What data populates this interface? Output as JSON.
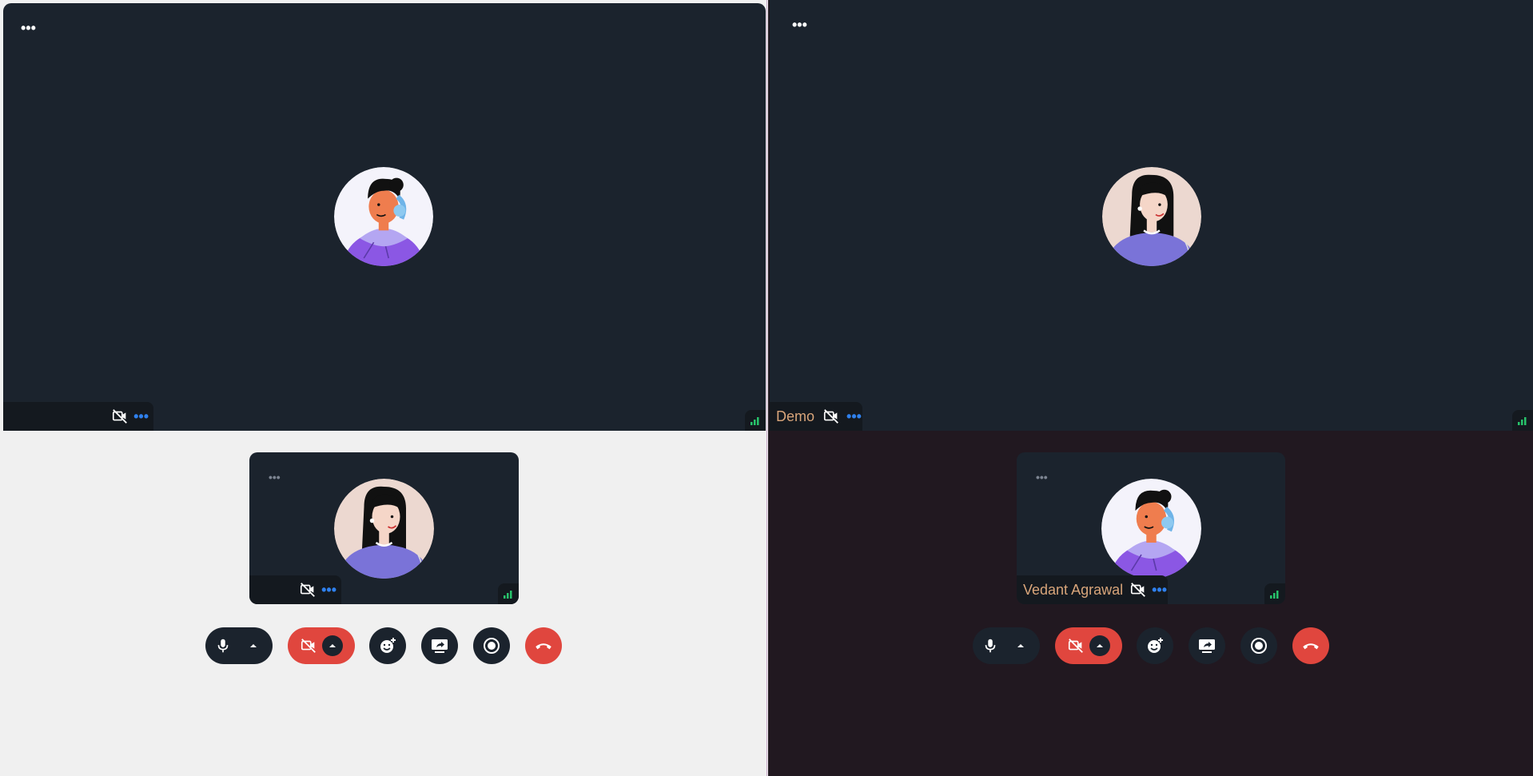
{
  "left_pane": {
    "main_tile": {
      "menu_icon": "more-horizontal-icon",
      "participant_name": "",
      "avatar": "avatar-headset-person",
      "video_off_icon": "video-off-icon",
      "options_icon": "more-horizontal-icon",
      "signal_icon": "signal-strength-icon"
    },
    "self_tile": {
      "menu_icon": "more-horizontal-icon",
      "participant_name": "",
      "avatar": "avatar-long-hair-person",
      "video_off_icon": "video-off-icon",
      "options_icon": "more-horizontal-icon",
      "signal_icon": "signal-strength-icon"
    }
  },
  "right_pane": {
    "main_tile": {
      "menu_icon": "more-horizontal-icon",
      "participant_name": "Demo",
      "avatar": "avatar-long-hair-person",
      "video_off_icon": "video-off-icon",
      "options_icon": "more-horizontal-icon",
      "signal_icon": "signal-strength-icon"
    },
    "self_tile": {
      "menu_icon": "more-horizontal-icon",
      "participant_name": "Vedant Agrawal",
      "avatar": "avatar-headset-person",
      "video_off_icon": "video-off-icon",
      "options_icon": "more-horizontal-icon",
      "signal_icon": "signal-strength-icon"
    }
  },
  "controls": [
    {
      "id": "mic",
      "icon": "microphone-icon",
      "secondary_icon": "chevron-up-icon"
    },
    {
      "id": "camera",
      "icon": "video-off-icon",
      "secondary_icon": "chevron-up-icon"
    },
    {
      "id": "reactions",
      "icon": "emoji-add-icon"
    },
    {
      "id": "share-screen",
      "icon": "screen-share-icon"
    },
    {
      "id": "record",
      "icon": "record-icon"
    },
    {
      "id": "leave",
      "icon": "phone-hangup-icon"
    }
  ],
  "colors": {
    "tile_bg": "#1b232d",
    "left_page_bg": "#f0f0f0",
    "right_page_bg": "#211820",
    "danger": "#e0463e",
    "accent": "#2f80ed",
    "signal": "#27c46b",
    "name_text": "#d8a57a"
  }
}
